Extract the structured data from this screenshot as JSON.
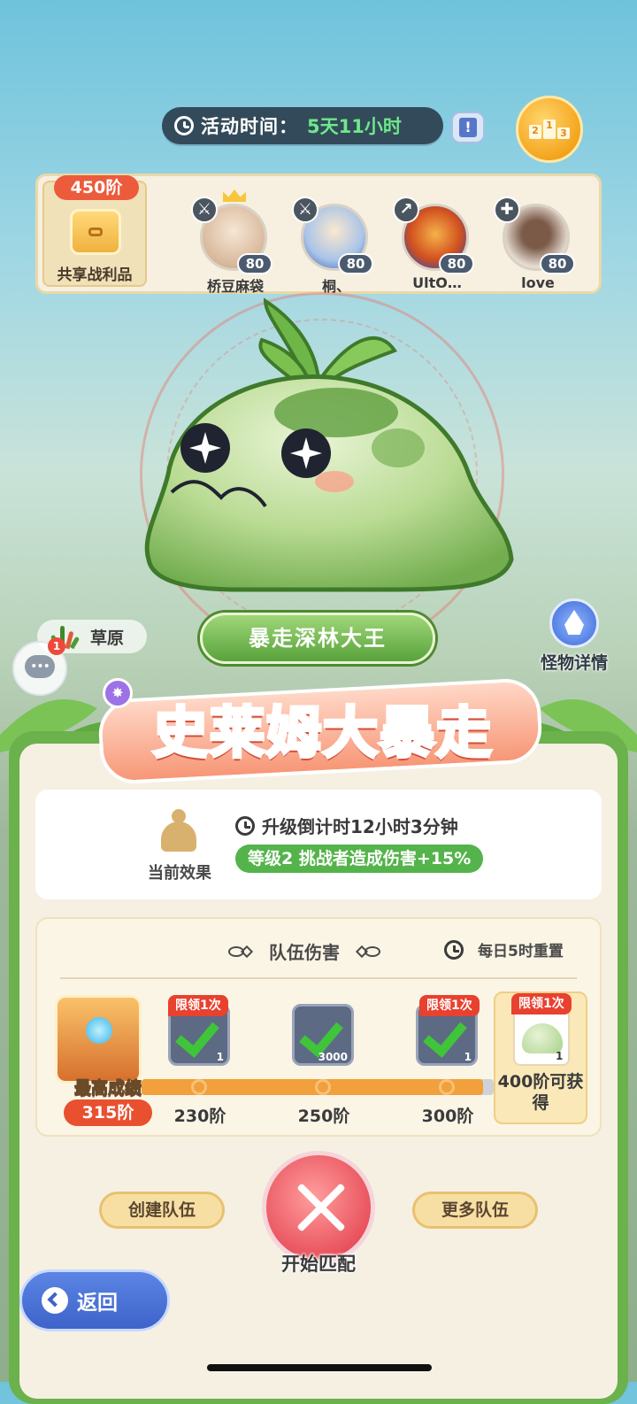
{
  "header": {
    "activity_time_label": "活动时间：",
    "activity_time_value": "5天11小时",
    "rank_podium": [
      "2",
      "1",
      "3"
    ]
  },
  "team": {
    "stage_badge": "450阶",
    "shared_loot_label": "共享战利品",
    "members": [
      {
        "name": "桥豆麻袋",
        "level": "80",
        "class_icon": "sword-icon",
        "leader": true
      },
      {
        "name": "桐、",
        "level": "80",
        "class_icon": "sword-icon",
        "leader": false
      },
      {
        "name": "UltO…",
        "level": "80",
        "class_icon": "lance-icon",
        "leader": false
      },
      {
        "name": "love",
        "level": "80",
        "class_icon": "cross-icon",
        "leader": false
      }
    ]
  },
  "boss": {
    "name": "暴走深林大王",
    "biome": "草原",
    "details_label": "怪物详情"
  },
  "chat": {
    "unread_count": "1"
  },
  "event": {
    "title": "史莱姆大暴走"
  },
  "effect": {
    "label": "当前效果",
    "countdown": "升级倒计时12小时3分钟",
    "buff": "等级2  挑战者造成伤害+15%"
  },
  "team_damage": {
    "title": "队伍伤害",
    "reset_label": "每日5时重置",
    "best_label": "最高成绩",
    "best_value": "315阶",
    "progress_fraction": 0.97,
    "milestones": [
      {
        "label": "230阶",
        "tag": "限领1次",
        "qty": "1",
        "claimed": true
      },
      {
        "label": "250阶",
        "tag": "",
        "qty": "3000",
        "claimed": true
      },
      {
        "label": "300阶",
        "tag": "限领1次",
        "qty": "1",
        "claimed": true
      }
    ],
    "final_reward": {
      "tag": "限领1次",
      "qty": "1",
      "label": "400阶可获得"
    }
  },
  "actions": {
    "create_team": "创建队伍",
    "start_match": "开始匹配",
    "more_teams": "更多队伍",
    "back": "返回"
  },
  "colors": {
    "accent_green": "#6bb14c",
    "progress_orange": "#f2a03c",
    "badge_red": "#e9502f",
    "time_green": "#6ee88a"
  }
}
